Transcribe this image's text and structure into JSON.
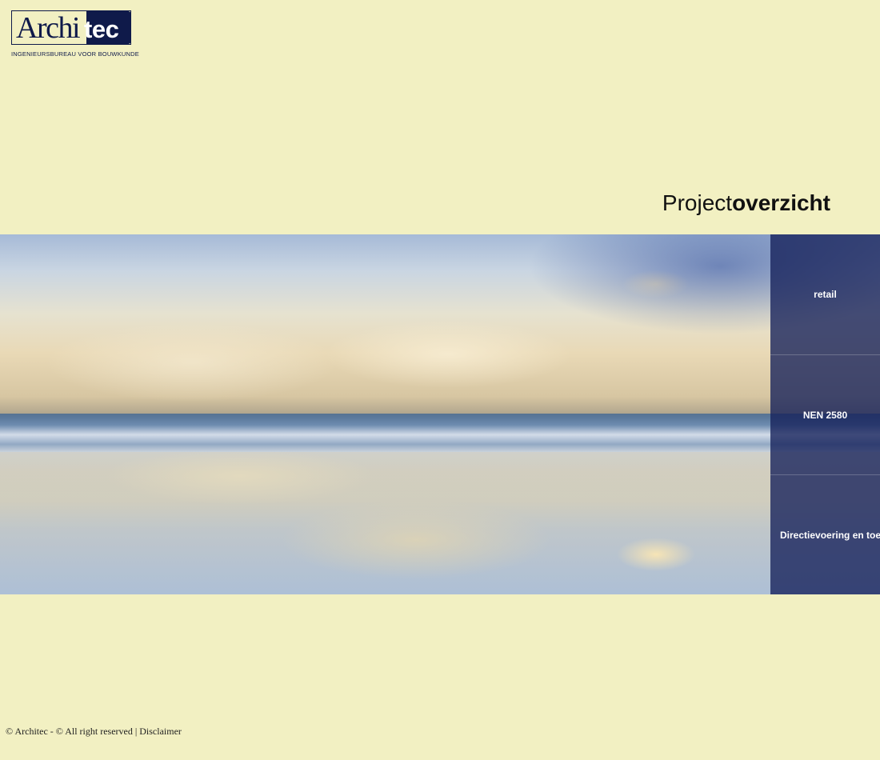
{
  "logo": {
    "wordmark_a": "Archi",
    "wordmark_b": "tec",
    "tagline": "INGENIEURSBUREAU VOOR BOUWKUNDE"
  },
  "heading": {
    "regular": "Project",
    "bold": "overzicht"
  },
  "side_nav": {
    "items": [
      {
        "label": "retail"
      },
      {
        "label": "NEN 2580"
      },
      {
        "label": "Directievoering en toez"
      }
    ]
  },
  "footer": {
    "copyright": "© Architec - © All right reserved | ",
    "disclaimer": "Disclaimer"
  },
  "colors": {
    "background": "#f2f0c2",
    "brand_navy": "#0f1a4a",
    "panel": "#14205a"
  }
}
